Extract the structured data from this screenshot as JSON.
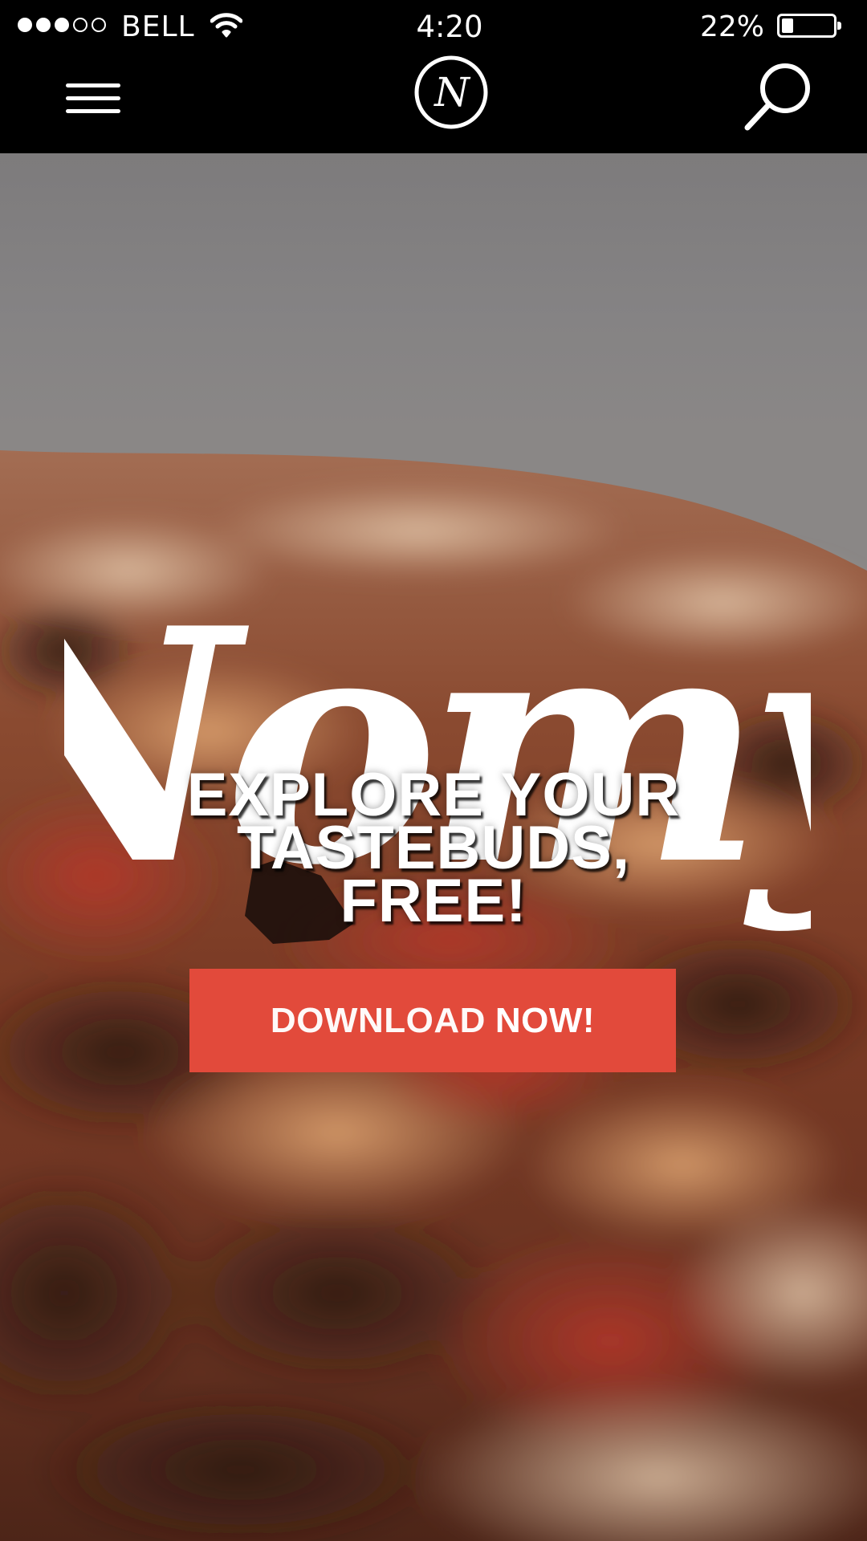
{
  "status_bar": {
    "signal_bars_total": 5,
    "signal_bars_filled": 3,
    "carrier": "BELL",
    "time": "4:20",
    "battery_percent_text": "22%",
    "battery_level": 0.22
  },
  "nav": {
    "menu_icon": "hamburger-menu-icon",
    "logo_letter": "N",
    "search_icon": "search-icon"
  },
  "hero": {
    "brand_name": "Nomy",
    "tagline_lines": [
      "EXPLORE YOUR",
      "TASTEBUDS,",
      "FREE!"
    ],
    "cta_part1": "DOWNLOAD",
    "cta_part2": "NOW!",
    "cta_color": "#e24a3b"
  },
  "colors": {
    "background": "#000000",
    "foreground": "#ffffff",
    "accent": "#e24a3b"
  }
}
